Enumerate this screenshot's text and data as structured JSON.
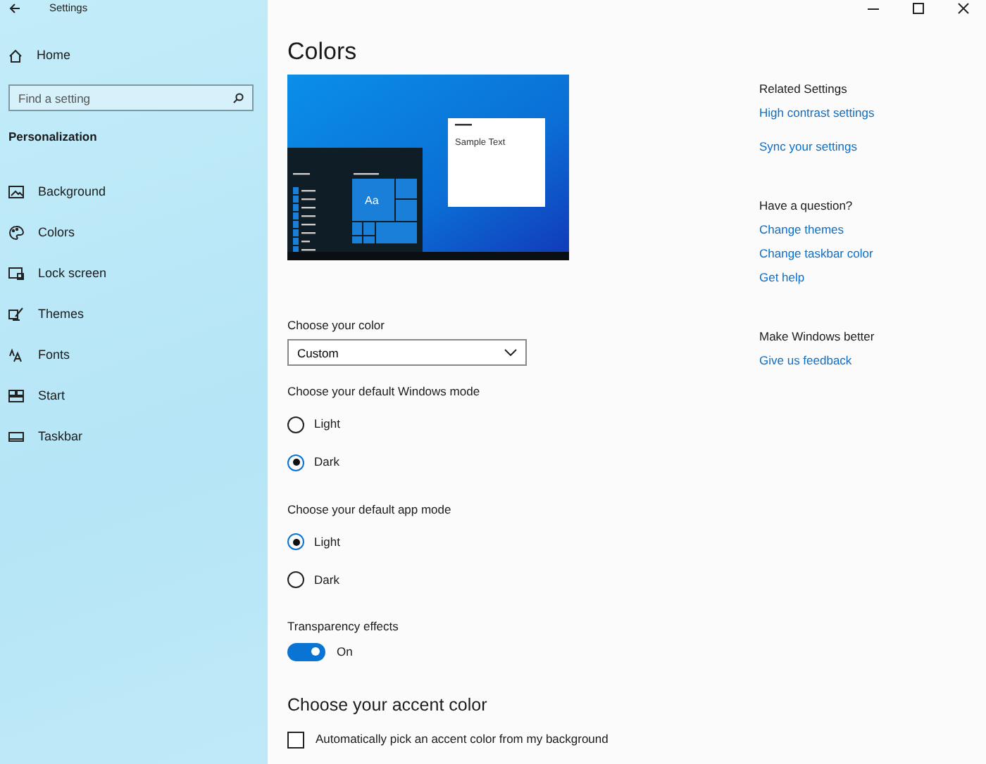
{
  "window": {
    "title": "Settings"
  },
  "sidebar": {
    "home": "Home",
    "search": {
      "placeholder": "Find a setting"
    },
    "section": "Personalization",
    "items": [
      {
        "label": "Background"
      },
      {
        "label": "Colors"
      },
      {
        "label": "Lock screen"
      },
      {
        "label": "Themes"
      },
      {
        "label": "Fonts"
      },
      {
        "label": "Start"
      },
      {
        "label": "Taskbar"
      }
    ]
  },
  "main": {
    "title": "Colors",
    "preview": {
      "sample_text": "Sample Text",
      "tile_text": "Aa"
    },
    "color_select": {
      "label": "Choose your color",
      "value": "Custom"
    },
    "radio_groups": [
      {
        "label": "Choose your default Windows mode",
        "options": [
          {
            "label": "Light",
            "selected": false
          },
          {
            "label": "Dark",
            "selected": true
          }
        ]
      },
      {
        "label": "Choose your default app mode",
        "options": [
          {
            "label": "Light",
            "selected": true
          },
          {
            "label": "Dark",
            "selected": false
          }
        ]
      }
    ],
    "transparency": {
      "label": "Transparency effects",
      "on": true,
      "state_text": "On"
    },
    "accent": {
      "heading": "Choose your accent color",
      "auto_pick": {
        "label": "Automatically pick an accent color from my background",
        "checked": false
      }
    }
  },
  "related": [
    {
      "heading": "Related Settings",
      "links": [
        "High contrast settings",
        "Sync your settings"
      ]
    },
    {
      "heading": "Have a question?",
      "links": [
        "Change themes",
        "Change taskbar color",
        "Get help"
      ]
    },
    {
      "heading": "Make Windows better",
      "links": [
        "Give us feedback"
      ]
    }
  ]
}
